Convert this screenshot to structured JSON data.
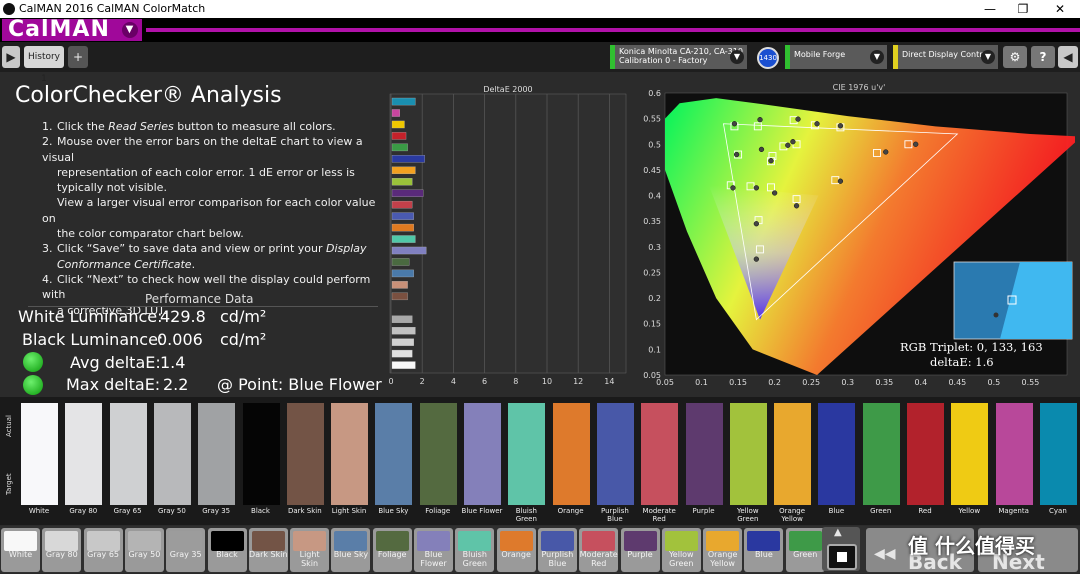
{
  "window": {
    "title": "CalMAN 2016 CalMAN ColorMatch"
  },
  "brand": {
    "name": "CalMAN"
  },
  "toolbar": {
    "tab": "History 1",
    "add_tab": "+",
    "meter_line1": "Konica Minolta CA-210, CA-310",
    "meter_line2": "Calibration 0 - Factory",
    "meter_badge": "1430",
    "source": "Mobile Forge",
    "display": "Direct Display Control"
  },
  "page": {
    "title": "ColorChecker® Analysis",
    "instructions": [
      {
        "n": "1.",
        "lines": [
          "Click the Read Series button to measure all colors."
        ]
      },
      {
        "n": "2.",
        "lines": [
          "Mouse over the error bars on the deltaE chart to view a visual",
          "representation of each color error. 1 dE error or less is",
          "typically not visible.",
          "View a larger visual error comparison for each color value on",
          "the color comparator chart below."
        ]
      },
      {
        "n": "3.",
        "lines": [
          "Click “Save” to save data and view or print your Display",
          "Conformance Certificate."
        ]
      },
      {
        "n": "4.",
        "lines": [
          "Click “Next” to check how well the display could perform with",
          "a corrective 3D LUT."
        ]
      }
    ]
  },
  "performance": {
    "heading": "Performance Data",
    "white_label": "White Luminance:",
    "white_value": "429.8",
    "black_label": "Black Luminance:",
    "black_value": "0.006",
    "unit": "cd/m²",
    "avg_label": "Avg deltaE:",
    "avg_value": "1.4",
    "max_label": "Max deltaE:",
    "max_value": "2.2",
    "point_label": "@ Point: Blue Flower",
    "status_color": "#22c022"
  },
  "chart_data": [
    {
      "type": "bar",
      "title": "DeltaE 2000",
      "orientation": "horizontal",
      "xlim": [
        0,
        15
      ],
      "xticks": [
        0,
        2,
        4,
        6,
        8,
        10,
        12,
        14
      ],
      "bars": [
        {
          "color": "#1a8fb0",
          "value": 1.5
        },
        {
          "color": "#c8459e",
          "value": 0.5
        },
        {
          "color": "#f0c800",
          "value": 0.8
        },
        {
          "color": "#c4212a",
          "value": 0.9
        },
        {
          "color": "#3a9a45",
          "value": 1.0
        },
        {
          "color": "#2a3aa0",
          "value": 2.1
        },
        {
          "color": "#f2a020",
          "value": 1.5
        },
        {
          "color": "#9ac23a",
          "value": 1.3
        },
        {
          "color": "#5a2a7a",
          "value": 2.0
        },
        {
          "color": "#c2404a",
          "value": 1.3
        },
        {
          "color": "#4a5ab0",
          "value": 1.4
        },
        {
          "color": "#e07a20",
          "value": 1.4
        },
        {
          "color": "#50c8a8",
          "value": 1.5
        },
        {
          "color": "#8080c0",
          "value": 2.2
        },
        {
          "color": "#4a6a40",
          "value": 1.1
        },
        {
          "color": "#4a7aaa",
          "value": 1.4
        },
        {
          "color": "#c89078",
          "value": 1.0
        },
        {
          "color": "#7a5040",
          "value": 1.0
        },
        {
          "color": "#101010",
          "value": 0.0
        },
        {
          "color": "#a8a8a8",
          "value": 1.3
        },
        {
          "color": "#c0c0c0",
          "value": 1.5
        },
        {
          "color": "#d0d0d0",
          "value": 1.4
        },
        {
          "color": "#e0e0e0",
          "value": 1.3
        },
        {
          "color": "#f8f8f8",
          "value": 1.5
        }
      ]
    },
    {
      "type": "scatter",
      "title": "CIE 1976 u'v'",
      "xlim": [
        0.05,
        0.6
      ],
      "ylim": [
        0.05,
        0.6
      ],
      "xticks": [
        0.05,
        0.1,
        0.15,
        0.2,
        0.25,
        0.3,
        0.35,
        0.4,
        0.45,
        0.5,
        0.55
      ],
      "yticks": [
        0.05,
        0.1,
        0.15,
        0.2,
        0.25,
        0.3,
        0.35,
        0.4,
        0.45,
        0.5,
        0.55,
        0.6
      ],
      "targets": [
        [
          0.145,
          0.535
        ],
        [
          0.177,
          0.535
        ],
        [
          0.226,
          0.547
        ],
        [
          0.255,
          0.537
        ],
        [
          0.29,
          0.533
        ],
        [
          0.212,
          0.496
        ],
        [
          0.23,
          0.5
        ],
        [
          0.15,
          0.48
        ],
        [
          0.197,
          0.477
        ],
        [
          0.34,
          0.483
        ],
        [
          0.383,
          0.5
        ],
        [
          0.195,
          0.467
        ],
        [
          0.14,
          0.42
        ],
        [
          0.167,
          0.418
        ],
        [
          0.195,
          0.416
        ],
        [
          0.283,
          0.43
        ],
        [
          0.23,
          0.393
        ],
        [
          0.178,
          0.352
        ],
        [
          0.18,
          0.295
        ]
      ],
      "measured": [
        [
          0.145,
          0.54
        ],
        [
          0.18,
          0.548
        ],
        [
          0.232,
          0.549
        ],
        [
          0.258,
          0.54
        ],
        [
          0.29,
          0.536
        ],
        [
          0.218,
          0.498
        ],
        [
          0.225,
          0.505
        ],
        [
          0.148,
          0.48
        ],
        [
          0.182,
          0.49
        ],
        [
          0.352,
          0.485
        ],
        [
          0.393,
          0.5
        ],
        [
          0.195,
          0.468
        ],
        [
          0.143,
          0.415
        ],
        [
          0.175,
          0.415
        ],
        [
          0.2,
          0.405
        ],
        [
          0.29,
          0.428
        ],
        [
          0.23,
          0.38
        ],
        [
          0.175,
          0.345
        ],
        [
          0.175,
          0.276
        ]
      ],
      "inset": {
        "rgb_label": "RGB Triplet: 0, 133, 163",
        "deltae_label": "deltaE: 1.6"
      }
    }
  ],
  "swatch_row": {
    "actual_label": "Actual",
    "target_label": "Target",
    "items": [
      {
        "name": "White",
        "color": "#f8f8fa"
      },
      {
        "name": "Gray 80",
        "color": "#e4e4e6"
      },
      {
        "name": "Gray 65",
        "color": "#cfd0d2"
      },
      {
        "name": "Gray 50",
        "color": "#b8b9bb"
      },
      {
        "name": "Gray 35",
        "color": "#a0a2a4"
      },
      {
        "name": "Black",
        "color": "#050505"
      },
      {
        "name": "Dark Skin",
        "color": "#735446"
      },
      {
        "name": "Light Skin",
        "color": "#c79883"
      },
      {
        "name": "Blue Sky",
        "color": "#5a7ea8"
      },
      {
        "name": "Foliage",
        "color": "#546a40"
      },
      {
        "name": "Blue Flower",
        "color": "#8480ba"
      },
      {
        "name": "Bluish Green",
        "color": "#5fc4a8"
      },
      {
        "name": "Orange",
        "color": "#de7a2c"
      },
      {
        "name": "Purplish Blue",
        "color": "#4858a8"
      },
      {
        "name": "Moderate Red",
        "color": "#c6505e"
      },
      {
        "name": "Purple",
        "color": "#5e3a6e"
      },
      {
        "name": "Yellow Green",
        "color": "#a2c23c"
      },
      {
        "name": "Orange Yellow",
        "color": "#e8a82e"
      },
      {
        "name": "Blue",
        "color": "#2a38a0"
      },
      {
        "name": "Green",
        "color": "#3e9a48"
      },
      {
        "name": "Red",
        "color": "#b2222c"
      },
      {
        "name": "Yellow",
        "color": "#efcb14"
      },
      {
        "name": "Magenta",
        "color": "#b8489a"
      },
      {
        "name": "Cyan",
        "color": "#0a8aae"
      }
    ]
  },
  "bottom_bar": {
    "items": [
      {
        "name": "White",
        "color": "#f8f8f8"
      },
      {
        "name": "Gray 80",
        "color": "#d8d8d8"
      },
      {
        "name": "Gray 65",
        "color": "#c8c8c8"
      },
      {
        "name": "Gray 50",
        "color": "#b4b4b4"
      },
      {
        "name": "Gray 35",
        "color": "#9c9c9c"
      },
      {
        "name": "Black",
        "color": "#000000"
      },
      {
        "name": "Dark Skin",
        "color": "#735446"
      },
      {
        "name": "Light Skin",
        "color": "#c79883"
      },
      {
        "name": "Blue Sky",
        "color": "#5a7ea8"
      },
      {
        "name": "Foliage",
        "color": "#546a40"
      },
      {
        "name": "Blue Flower",
        "color": "#8480ba"
      },
      {
        "name": "Bluish Green",
        "color": "#5fc4a8"
      },
      {
        "name": "Orange",
        "color": "#de7a2c"
      },
      {
        "name": "Purplish Blue",
        "color": "#4858a8"
      },
      {
        "name": "Moderate Red",
        "color": "#c6505e"
      },
      {
        "name": "Purple",
        "color": "#5e3a6e"
      },
      {
        "name": "Yellow Green",
        "color": "#a2c23c"
      },
      {
        "name": "Orange Yellow",
        "color": "#e8a82e"
      },
      {
        "name": "Blue",
        "color": "#2a38a0"
      },
      {
        "name": "Green",
        "color": "#3e9a48"
      }
    ],
    "back_label": "Back",
    "next_label": "Next",
    "watermark": "值 什么值得买"
  }
}
